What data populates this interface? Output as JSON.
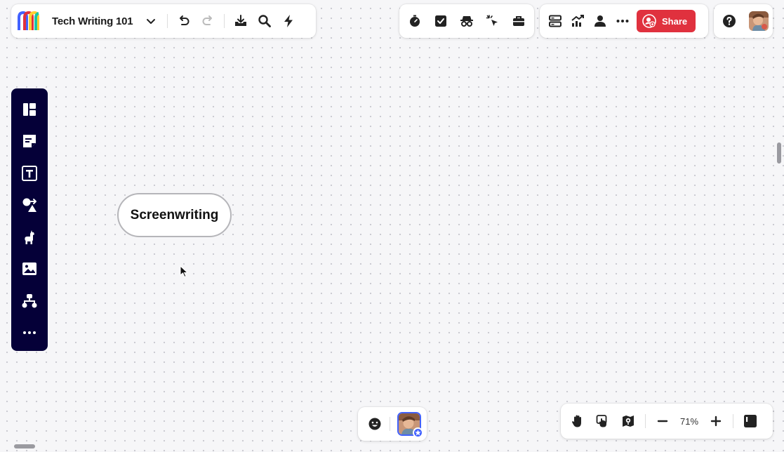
{
  "board": {
    "title": "Tech Writing 101"
  },
  "header": {
    "share_label": "Share"
  },
  "canvas": {
    "shape_text": "Screenwriting"
  },
  "zoom": {
    "level": "71%"
  },
  "icons": {
    "board_toolbar": [
      "miro-logo-icon",
      "chevron-down-icon",
      "undo-icon",
      "redo-icon",
      "export-icon",
      "search-icon",
      "lightning-icon"
    ],
    "tools": [
      "timer-icon",
      "checkbox-icon",
      "spy-icon",
      "pointer-click-icon",
      "briefcase-icon"
    ],
    "collab": [
      "cards-icon",
      "chart-icon",
      "person-icon",
      "more-icon",
      "share-person-icon"
    ],
    "user": [
      "help-icon",
      "avatar"
    ],
    "left_toolbar": [
      "templates-icon",
      "sticky-note-icon",
      "text-icon",
      "shapes-icon",
      "llama-icon",
      "image-icon",
      "diagram-icon",
      "more-icon"
    ],
    "bottom": [
      "emoji-icon",
      "presenter-avatar",
      "hand-icon",
      "touch-icon",
      "map-icon",
      "zoom-out-icon",
      "zoom-in-icon",
      "panel-toggle-icon"
    ]
  },
  "colors": {
    "accent": "#e0313e",
    "left_toolbar": "#050038",
    "presenter_border": "#4262ff"
  }
}
